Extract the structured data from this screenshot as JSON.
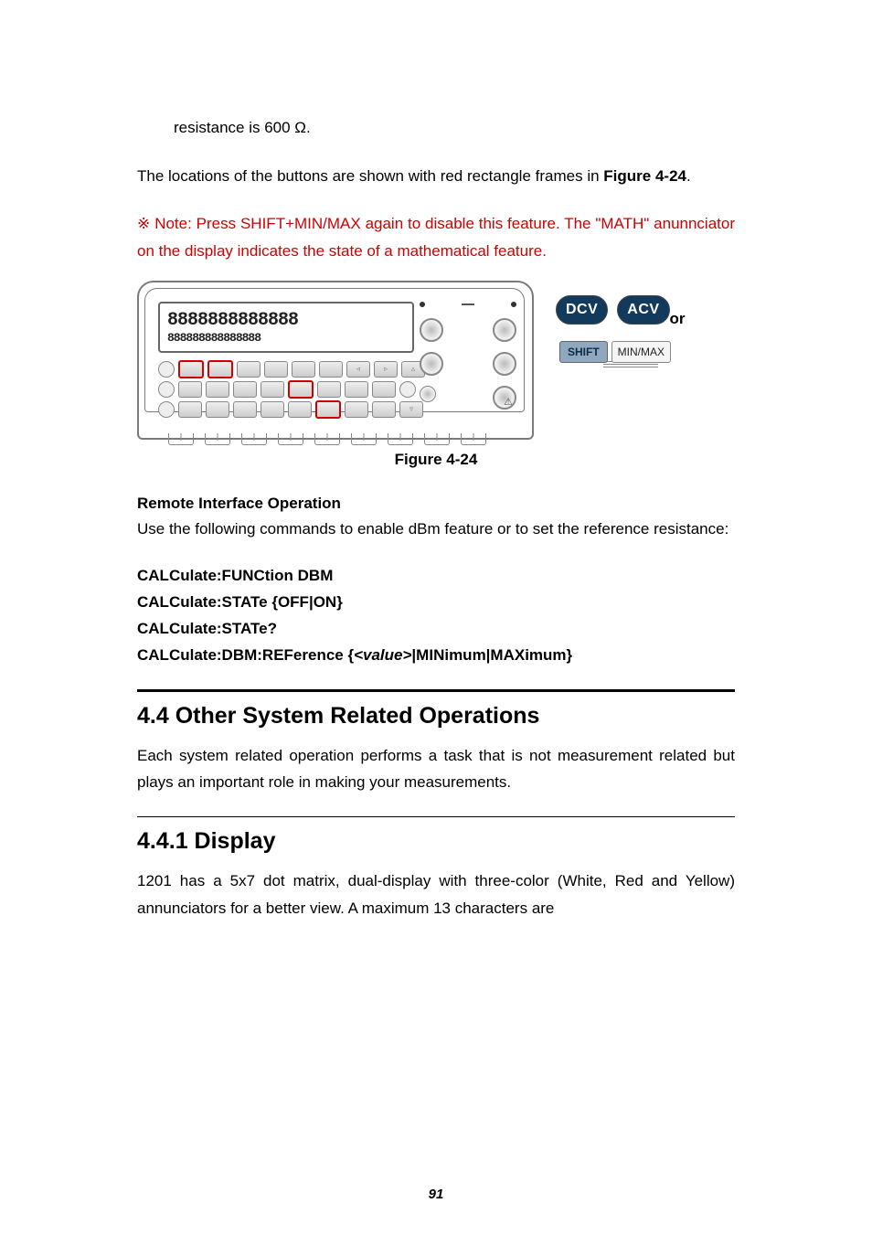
{
  "indent_line": "resistance is 600 Ω.",
  "para_locations_1": "The locations of the buttons are shown with red rectangle frames in ",
  "para_locations_fig": "Figure 4-24",
  "para_locations_2": ".",
  "note_text": "※ Note: Press SHIFT+MIN/MAX again to disable this feature. The \"MATH\" anunnciator on the display indicates the state of a mathematical feature.",
  "lcd_big": "8888888888888",
  "lcd_small": "888888888888888",
  "side_controls": {
    "dcv": "DCV",
    "acv": "ACV",
    "or": "or",
    "shift": "SHIFT",
    "minmax": "MIN/MAX"
  },
  "fig_caption": "Figure 4-24",
  "remote_heading": "Remote Interface Operation",
  "remote_para": "Use the following commands to enable dBm feature or to set the reference resistance:",
  "commands": {
    "l1": "CALCulate:FUNCtion DBM",
    "l2": "CALCulate:STATe {OFF|ON}",
    "l3": "CALCulate:STATe?",
    "l4a": "CALCulate:DBM:REFerence {",
    "l4b": "<value>",
    "l4c": "|MINimum|MAXimum}"
  },
  "section_4_4": "4.4   Other System Related Operations",
  "section_4_4_para": "Each system related operation performs a task that is not measurement related but plays an important role in making your measurements.",
  "section_4_4_1": "4.4.1   Display",
  "section_4_4_1_para": "1201 has a 5x7 dot matrix, dual-display with three-color (White, Red and Yellow) annunciators for a better view. A maximum 13 characters are",
  "page_number": "91"
}
